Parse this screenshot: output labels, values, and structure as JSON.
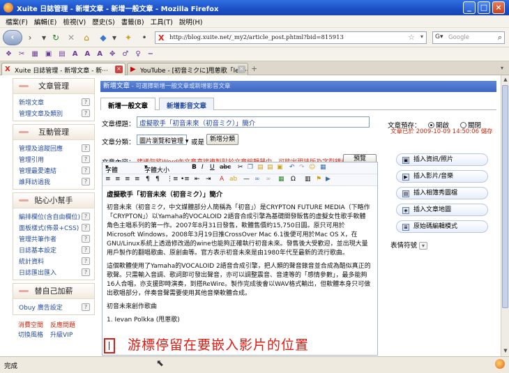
{
  "window": {
    "title": "Xuite 日誌管理 - 新增文章 - 新增一般文章 - Mozilla Firefox"
  },
  "menu": [
    "檔案(F)",
    "編輯(E)",
    "檢視(V)",
    "歷史(S)",
    "書籤(B)",
    "工具(T)",
    "說明(H)"
  ],
  "navbar": {
    "url": "http://blog.xuite.net/_my2/article_post.phtml?bid=815913",
    "search_placeholder": "Google"
  },
  "tabs": [
    {
      "label": "Xuite 日誌管理 - 新增文章 - 新···",
      "active": true
    },
    {
      "label": "YouTube - [初音ミクに]甩蔥歌「lev···",
      "active": false
    }
  ],
  "sidebar": {
    "panels": [
      {
        "title": "文章管理",
        "items": [
          {
            "label": "新增文章"
          },
          {
            "label": "管理文章及類別"
          }
        ]
      },
      {
        "title": "互動管理",
        "items": [
          {
            "label": "管理及追蹤回應"
          },
          {
            "label": "管理引用"
          },
          {
            "label": "管理最愛連結"
          },
          {
            "label": "誰拜訪過我"
          }
        ]
      },
      {
        "title": "貼心小幫手",
        "items": [
          {
            "label": "編排欄位(含自由欄位)"
          },
          {
            "label": "面板樣式(佈景+CSS)"
          },
          {
            "label": "管理共筆作者"
          },
          {
            "label": "日誌基本設定"
          },
          {
            "label": "統計資料"
          },
          {
            "label": "日誌匯出匯入"
          }
        ]
      },
      {
        "title": "替自己加薪",
        "items": [
          {
            "label": "Obuy 廣告設定"
          }
        ]
      }
    ],
    "pairs": [
      {
        "left": "消費空間",
        "right": "反應問題"
      },
      {
        "left": "切換風格",
        "right": "升級VIP"
      }
    ]
  },
  "main": {
    "header": "新增文章",
    "header_sub": " - 可選擇新增一般文章或新增影音文章",
    "content_tabs": [
      "新增一般文章",
      "新增影音文章"
    ],
    "title_label": "文章標題：",
    "title_value": "虛擬歌手「初音未來（初音ミク）」簡介",
    "category_label": "文章分類：",
    "category_value": "圖片瀏覽和管理",
    "or_label": "或是",
    "new_category_button": "新增分類",
    "content_label": "文章內容：",
    "warning": "建議勿將Word內文章直接複製貼於文章編輯器中，可能出現排版及字型錯誤。",
    "preview_button": "預覽",
    "editor": {
      "toolbar_font": "字體",
      "toolbar_size": "字體大小",
      "heading": "虛擬歌手「初音未來（初音ミク）」簡介",
      "para1": "初音未來（初音ミク，中文媒體部分人簡稱為「初音」）是CRYPTON FUTURE MEDIA（下略作「CRYPTON」）以Yamaha的VOCALOID 2語音合成引擎為基礎開發販售的虛擬女性歌手軟體角色主唱系列的第一作。2007年8月31日發售，軟體售價約15,750日圓。原只可用於Microsoft Windows，2008年3月19日推CrossOver Mac 6.1後便可用於Mac OS X，在GNU/Linux系統上透過修改過的wine也能夠正確執行初音未來。發售後大受歡迎，並出現大量用戶製作的翻唱歌曲、原創曲等。官方表示初音未來是由1980年代至最新的流行歌曲。",
      "para2": "這個軟體使用了Yamaha的VOCALOID 2語音合成引擎，把人類的聲音錄音並合成為酷似真正的歌聲。只需輸入音調、歌詞即可發出聲音，亦可以調整震音、音速等的「感情參數」，最多能夠16人合唱，亦支援即時演奏，到搭ReWire。製作完成後會以WAV格式輸出，但軟體本身只可做出歌唱部分，伴奏音聲需要使用其他音樂軟體合成。",
      "subheading": "初音未來創作歌曲",
      "list_item": "1. Ievan Polkka (甩蔥歌)"
    },
    "overlay_note": "游標停留在要嵌入影片的位置"
  },
  "rightcol": {
    "preview_label": "文章預存：",
    "radio_on": "開啟",
    "radio_off": "關閉",
    "saved_status": "文章已於 2009-10-09 14:50:06 儲存",
    "buttons": [
      "插入資訊/照片",
      "插入影片/音樂",
      "插入相簿秀圖檔",
      "插入文章地圖",
      "原始碼編輯模式"
    ],
    "emoticon_label": "表情符號"
  },
  "statusbar": {
    "text": "完成"
  }
}
